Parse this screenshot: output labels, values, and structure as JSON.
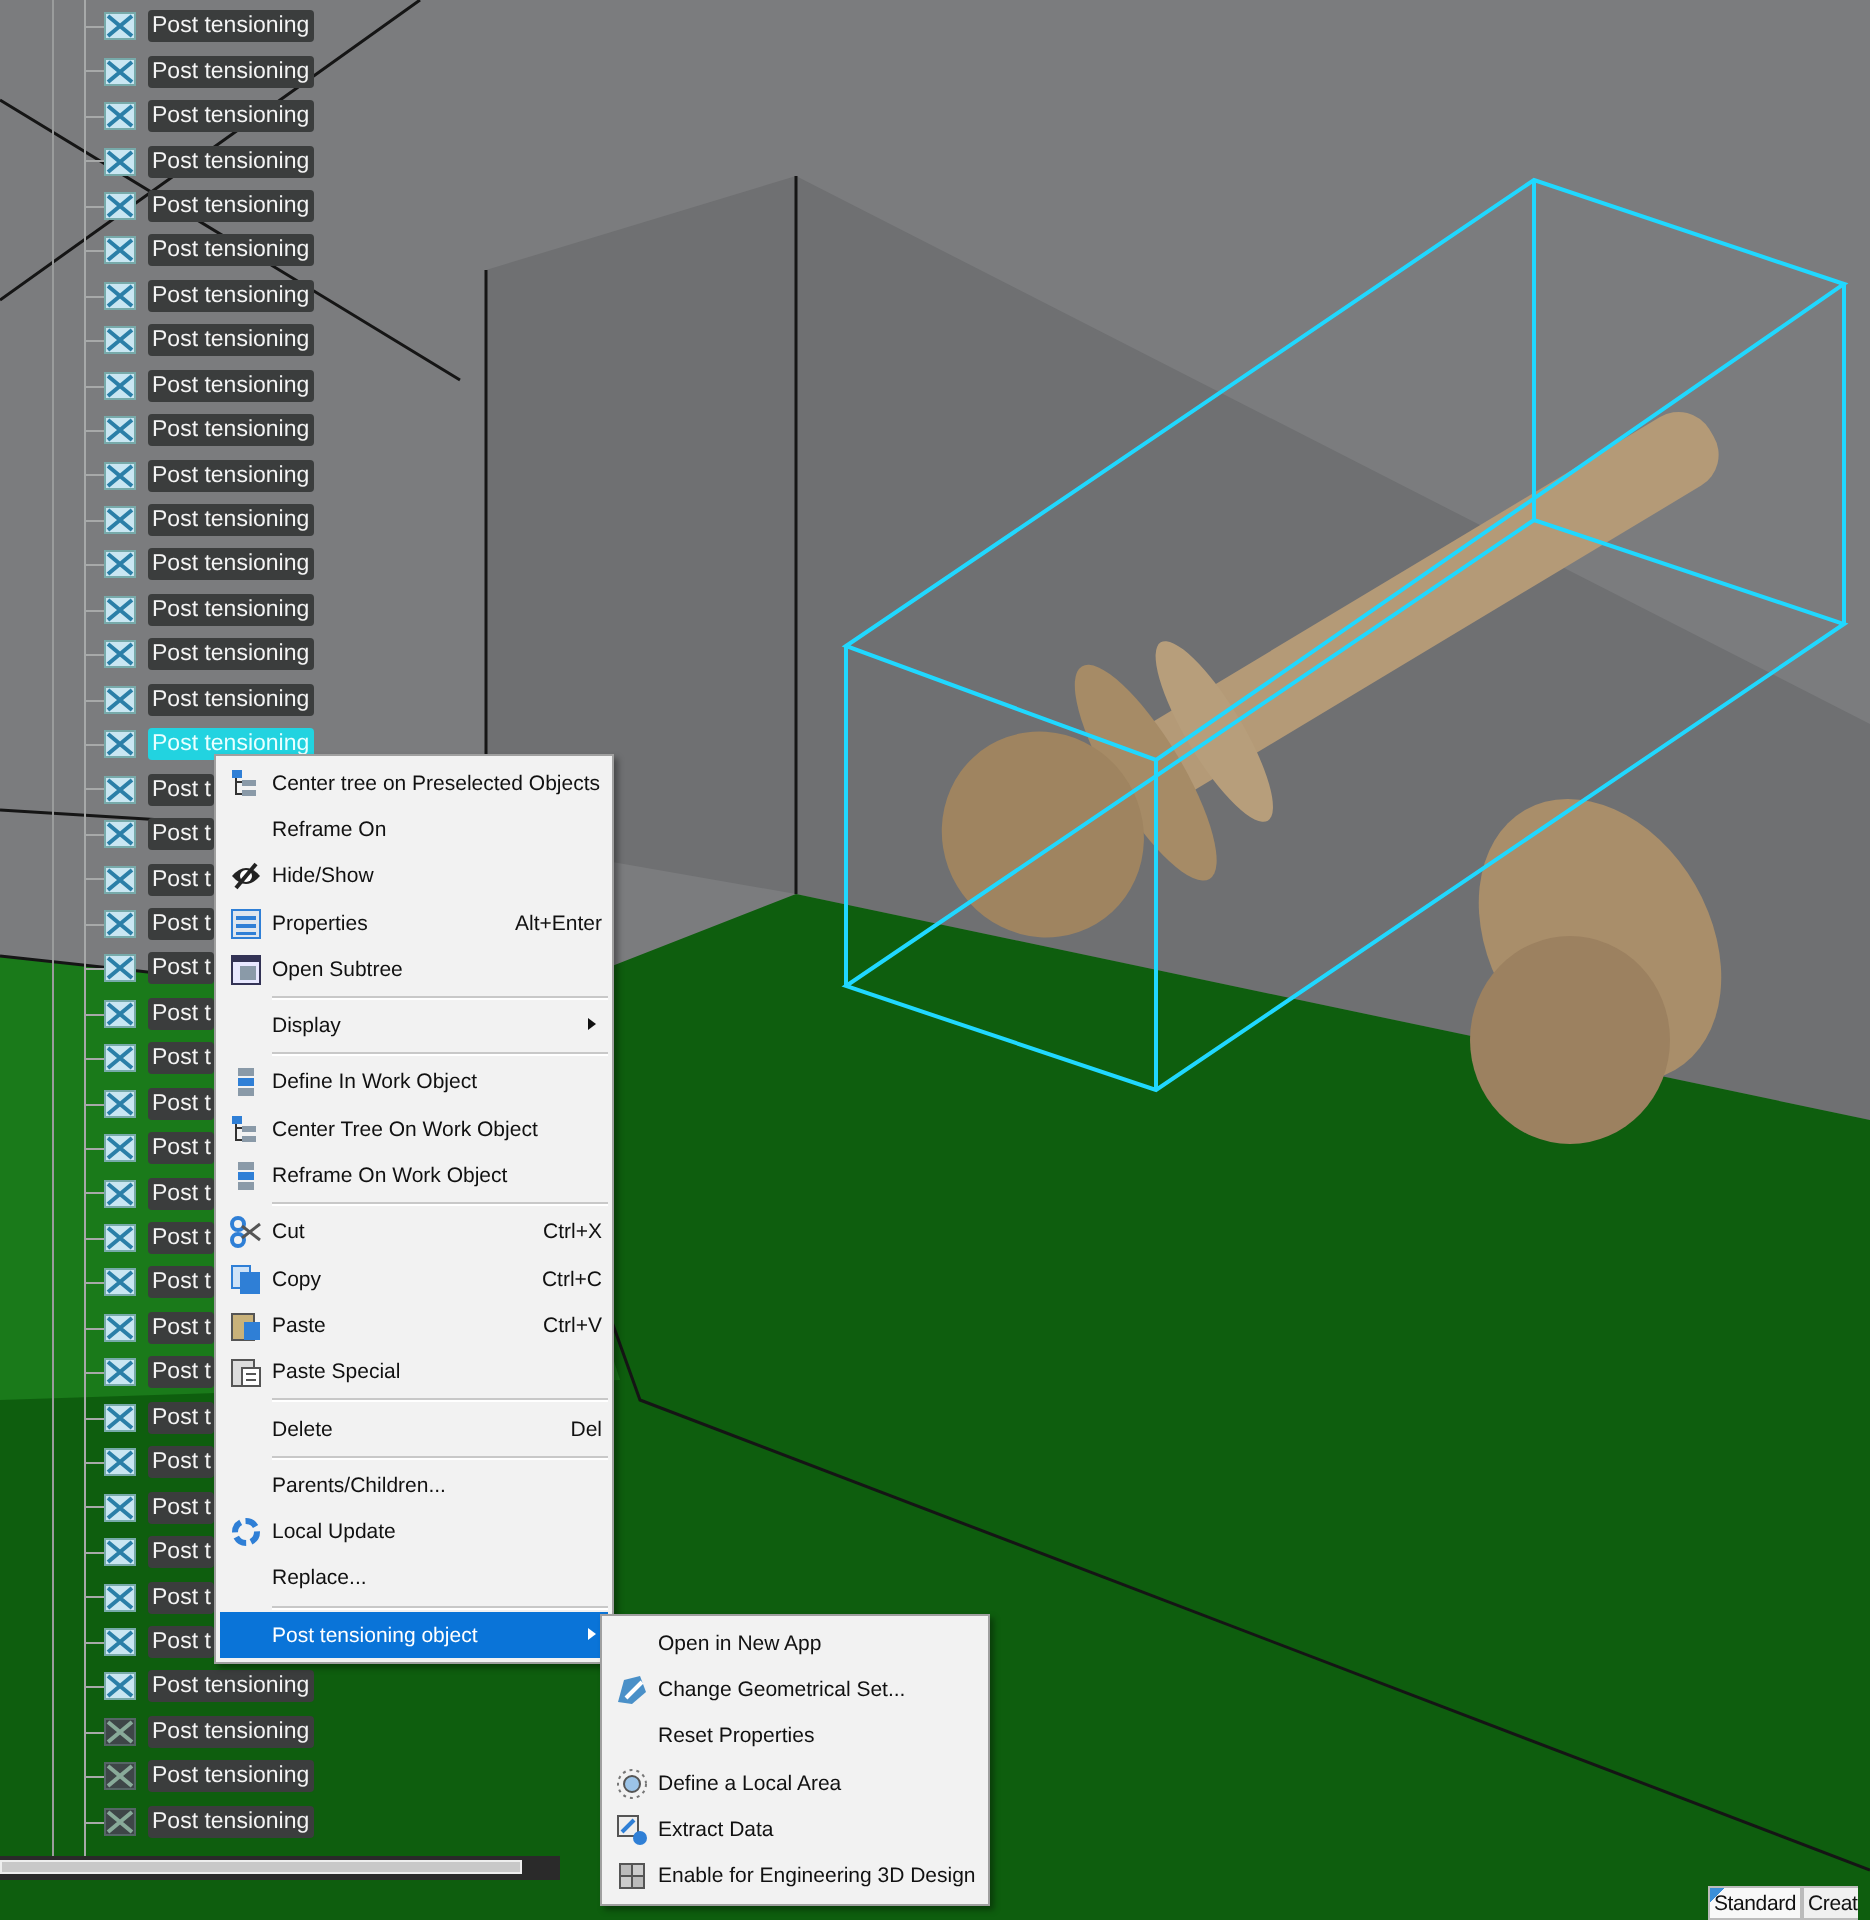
{
  "tree": {
    "items": [
      {
        "label": "Post tensioning",
        "selected": false,
        "hidden": false
      },
      {
        "label": "Post tensioning",
        "selected": false,
        "hidden": false
      },
      {
        "label": "Post tensioning",
        "selected": false,
        "hidden": false
      },
      {
        "label": "Post tensioning",
        "selected": false,
        "hidden": false
      },
      {
        "label": "Post tensioning",
        "selected": false,
        "hidden": false
      },
      {
        "label": "Post tensioning",
        "selected": false,
        "hidden": false
      },
      {
        "label": "Post tensioning",
        "selected": false,
        "hidden": false
      },
      {
        "label": "Post tensioning",
        "selected": false,
        "hidden": false
      },
      {
        "label": "Post tensioning",
        "selected": false,
        "hidden": false
      },
      {
        "label": "Post tensioning",
        "selected": false,
        "hidden": false
      },
      {
        "label": "Post tensioning",
        "selected": false,
        "hidden": false
      },
      {
        "label": "Post tensioning",
        "selected": false,
        "hidden": false
      },
      {
        "label": "Post tensioning",
        "selected": false,
        "hidden": false
      },
      {
        "label": "Post tensioning",
        "selected": false,
        "hidden": false
      },
      {
        "label": "Post tensioning",
        "selected": false,
        "hidden": false
      },
      {
        "label": "Post tensioning",
        "selected": false,
        "hidden": false
      },
      {
        "label": "Post tensioning",
        "selected": true,
        "hidden": false
      },
      {
        "label": "Post t",
        "selected": false,
        "hidden": false
      },
      {
        "label": "Post t",
        "selected": false,
        "hidden": false
      },
      {
        "label": "Post t",
        "selected": false,
        "hidden": false
      },
      {
        "label": "Post t",
        "selected": false,
        "hidden": false
      },
      {
        "label": "Post t",
        "selected": false,
        "hidden": false
      },
      {
        "label": "Post t",
        "selected": false,
        "hidden": false
      },
      {
        "label": "Post t",
        "selected": false,
        "hidden": false
      },
      {
        "label": "Post t",
        "selected": false,
        "hidden": false
      },
      {
        "label": "Post t",
        "selected": false,
        "hidden": false
      },
      {
        "label": "Post t",
        "selected": false,
        "hidden": false
      },
      {
        "label": "Post t",
        "selected": false,
        "hidden": false
      },
      {
        "label": "Post t",
        "selected": false,
        "hidden": false
      },
      {
        "label": "Post t",
        "selected": false,
        "hidden": false
      },
      {
        "label": "Post t",
        "selected": false,
        "hidden": false
      },
      {
        "label": "Post t",
        "selected": false,
        "hidden": false
      },
      {
        "label": "Post t",
        "selected": false,
        "hidden": false
      },
      {
        "label": "Post t",
        "selected": false,
        "hidden": false
      },
      {
        "label": "Post t",
        "selected": false,
        "hidden": false
      },
      {
        "label": "Post t",
        "selected": false,
        "hidden": false
      },
      {
        "label": "Post t",
        "selected": false,
        "hidden": false
      },
      {
        "label": "Post tensioning",
        "selected": false,
        "hidden": false
      },
      {
        "label": "Post tensioning",
        "selected": false,
        "hidden": true
      },
      {
        "label": "Post tensioning",
        "selected": false,
        "hidden": true
      },
      {
        "label": "Post tensioning",
        "selected": false,
        "hidden": true
      }
    ]
  },
  "context_menu": {
    "items": [
      {
        "kind": "item",
        "label": "Center tree on Preselected Objects",
        "selected": false
      },
      {
        "kind": "item",
        "label": "Reframe On",
        "selected": false
      },
      {
        "kind": "item",
        "label": "Hide/Show",
        "selected": false
      },
      {
        "kind": "item",
        "label": "Properties",
        "shortcut": "Alt+Enter",
        "selected": false
      },
      {
        "kind": "item",
        "label": "Open Subtree",
        "selected": false
      },
      {
        "kind": "separator"
      },
      {
        "kind": "item",
        "label": "Display",
        "has_submenu": true,
        "selected": false
      },
      {
        "kind": "separator"
      },
      {
        "kind": "item",
        "label": "Define In Work Object",
        "selected": false
      },
      {
        "kind": "item",
        "label": "Center Tree On Work Object",
        "selected": false
      },
      {
        "kind": "item",
        "label": "Reframe On Work Object",
        "selected": false
      },
      {
        "kind": "separator"
      },
      {
        "kind": "item",
        "label": "Cut",
        "shortcut": "Ctrl+X",
        "selected": false
      },
      {
        "kind": "item",
        "label": "Copy",
        "shortcut": "Ctrl+C",
        "selected": false
      },
      {
        "kind": "item",
        "label": "Paste",
        "shortcut": "Ctrl+V",
        "selected": false
      },
      {
        "kind": "item",
        "label": "Paste Special",
        "selected": false
      },
      {
        "kind": "separator"
      },
      {
        "kind": "item",
        "label": "Delete",
        "shortcut": "Del",
        "selected": false
      },
      {
        "kind": "separator"
      },
      {
        "kind": "item",
        "label": "Parents/Children...",
        "selected": false
      },
      {
        "kind": "item",
        "label": "Local Update",
        "selected": false
      },
      {
        "kind": "item",
        "label": "Replace...",
        "selected": false
      },
      {
        "kind": "separator"
      },
      {
        "kind": "item",
        "label": "Post tensioning object",
        "has_submenu": true,
        "selected": true
      }
    ]
  },
  "submenu": {
    "items": [
      {
        "label": "Open in New App"
      },
      {
        "label": "Change Geometrical Set..."
      },
      {
        "label": "Reset Properties"
      },
      {
        "label": "Define a Local Area"
      },
      {
        "label": "Extract Data"
      },
      {
        "label": "Enable for Engineering 3D Design"
      }
    ]
  },
  "tabs": [
    {
      "label": "Standard",
      "selected": true
    },
    {
      "label": "Creat",
      "selected": false
    }
  ]
}
